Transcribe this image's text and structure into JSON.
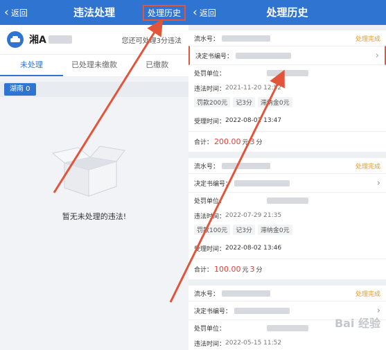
{
  "left": {
    "nav": {
      "back_label": "返回",
      "title": "违法处理",
      "history_label": "处理历史"
    },
    "car": {
      "plate_prefix": "湘A",
      "note": "您还可处理3分违法"
    },
    "tabs": [
      "未处理",
      "已处理未缴款",
      "已缴款"
    ],
    "region_badge": "湖南 0",
    "empty_text": "暂无未处理的违法!"
  },
  "right": {
    "nav": {
      "back_label": "返回",
      "title": "处理历史"
    },
    "records": [
      {
        "serial_label": "流水号：",
        "status": "处理完成",
        "decision_label": "决定书编号：",
        "unit_label": "处罚单位：",
        "time_label": "违法时间：",
        "time": "2021-11-20 12:52",
        "tags": [
          "罚款200元",
          "记3分",
          "滞纳金0元"
        ],
        "accept_label": "受理时间：",
        "accept_time": "2022-08-02 13:47",
        "total_label": "合计：",
        "amount": "200.00",
        "yuan": "元",
        "points": "3",
        "fen": "分"
      },
      {
        "serial_label": "流水号：",
        "status": "处理完成",
        "decision_label": "决定书编号：",
        "unit_label": "处罚单位：",
        "time_label": "违法时间：",
        "time": "2022-07-29 21:35",
        "tags": [
          "罚款100元",
          "记3分",
          "滞纳金0元"
        ],
        "accept_label": "受理时间：",
        "accept_time": "2022-08-02 13:46",
        "total_label": "合计：",
        "amount": "100.00",
        "yuan": "元",
        "points": "3",
        "fen": "分"
      },
      {
        "serial_label": "流水号：",
        "status": "处理完成",
        "decision_label": "决定书编号：",
        "unit_label": "处罚单位：",
        "time_label": "违法时间：",
        "time": "2022-05-15 11:52"
      }
    ],
    "watermark": "Bai 经验"
  },
  "colors": {
    "brand": "#2f74d0",
    "highlight": "#e2553a",
    "status": "#e39a2f",
    "amount": "#e04035"
  }
}
